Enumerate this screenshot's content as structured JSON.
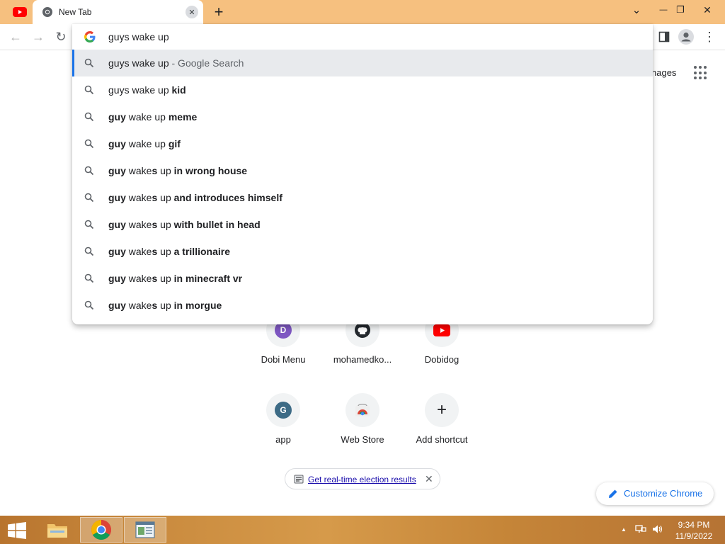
{
  "browser": {
    "tab_title": "New Tab",
    "tab_close_glyph": "✕",
    "new_tab_glyph": "+",
    "window_controls": {
      "dropdown": "⌄",
      "minimize": "—",
      "restore": "❐",
      "close": "✕"
    }
  },
  "toolbar": {
    "back_glyph": "←",
    "forward_glyph": "→",
    "reload_glyph": "↻",
    "menu_glyph": "⋮"
  },
  "omnibox": {
    "input_value": "guys wake up",
    "suggestions": [
      {
        "plain": "guys wake up",
        "bold": "",
        "rest": "",
        "suffix": " - Google Search"
      },
      {
        "plain": "guys wake up ",
        "bold": "kid",
        "rest": "",
        "suffix": ""
      },
      {
        "pre": "guy",
        "plain": " wake up ",
        "bold": "meme"
      },
      {
        "pre": "guy",
        "plain": " wake up ",
        "bold": "gif"
      },
      {
        "pre": "guy",
        "plain": " wake",
        "mid": "s",
        "plain2": " up ",
        "bold": "in wrong house"
      },
      {
        "pre": "guy",
        "plain": " wake",
        "mid": "s",
        "plain2": " up ",
        "bold": "and introduces himself"
      },
      {
        "pre": "guy",
        "plain": " wake",
        "mid": "s",
        "plain2": " up ",
        "bold": "with bullet in head"
      },
      {
        "pre": "guy",
        "plain": " wake",
        "mid": "s",
        "plain2": " up ",
        "bold": "a trillionaire"
      },
      {
        "pre": "guy",
        "plain": " wake",
        "mid": "s",
        "plain2": " up ",
        "bold": "in minecraft vr"
      },
      {
        "pre": "guy",
        "plain": " wake",
        "mid": "s",
        "plain2": " up ",
        "bold": "in morgue"
      }
    ]
  },
  "ntp": {
    "images_link": "nages",
    "shortcuts": [
      {
        "label": "Dobi Menu",
        "letter": "D",
        "color": "#7e57c2"
      },
      {
        "label": "mohamedko...",
        "icon": "github-icon"
      },
      {
        "label": "Dobidog",
        "icon": "youtube-icon"
      },
      {
        "label": "app",
        "letter": "G",
        "color": "#3d6b86"
      },
      {
        "label": "Web Store",
        "icon": "web-store-icon"
      },
      {
        "label": "Add shortcut",
        "glyph": "+"
      }
    ],
    "promo_text": "Get real-time election results",
    "promo_close": "✕",
    "customize_label": "Customize Chrome"
  },
  "taskbar": {
    "time": "9:34 PM",
    "date": "11/9/2022",
    "tray_arrow": "▲"
  },
  "colors": {
    "tabstrip": "#f6c07f",
    "accent_blue": "#1a73e8",
    "youtube_red": "#ff0000"
  }
}
